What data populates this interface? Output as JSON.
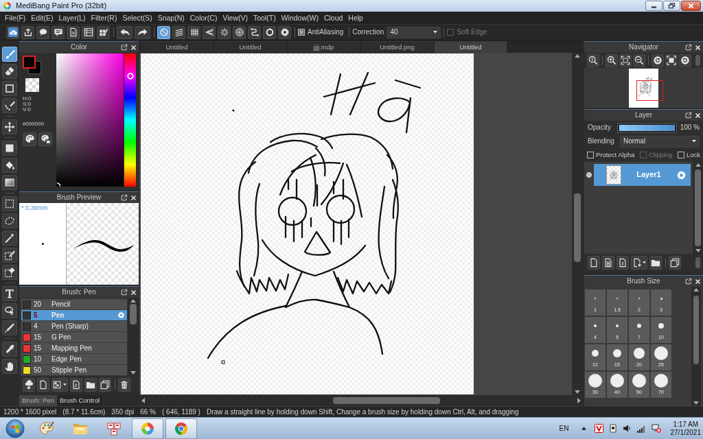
{
  "window": {
    "title": "MediBang Paint Pro (32bit)"
  },
  "menu": [
    "File(F)",
    "Edit(E)",
    "Layer(L)",
    "Filter(R)",
    "Select(S)",
    "Snap(N)",
    "Color(C)",
    "View(V)",
    "Tool(T)",
    "Window(W)",
    "Cloud",
    "Help"
  ],
  "toolbar": {
    "snap_modes": [
      {
        "selected": true
      },
      {
        "selected": false
      },
      {
        "selected": false
      },
      {
        "selected": false
      },
      {
        "selected": false
      },
      {
        "selected": false
      },
      {
        "selected": false
      },
      {
        "selected": false
      }
    ],
    "antialiasing": {
      "label": "AntiAliasing",
      "checked": true
    },
    "correction": {
      "label": "Correction",
      "value": "40"
    },
    "soft_edge": {
      "label": "Soft Edge",
      "checked": false,
      "disabled": true
    }
  },
  "tool_groups": [
    [
      {
        "selected": true
      },
      {
        "selected": false
      },
      {
        "selected": false
      },
      {
        "selected": false
      }
    ],
    [
      {
        "selected": false
      }
    ],
    [
      {
        "selected": false
      },
      {
        "selected": false
      },
      {
        "selected": false
      }
    ],
    [
      {
        "selected": false
      },
      {
        "selected": false
      },
      {
        "selected": false
      },
      {
        "selected": false
      },
      {
        "selected": false
      }
    ],
    [
      {
        "selected": false
      },
      {
        "selected": false
      },
      {
        "selected": false
      }
    ],
    [
      {
        "selected": false
      },
      {
        "selected": false
      }
    ]
  ],
  "color_panel": {
    "title": "Color",
    "hsv": [
      "H:0",
      "S:0",
      "V:0"
    ],
    "hex": "#000000",
    "hue_slider": {
      "level": 0.85
    }
  },
  "brush_preview": {
    "title": "Brush Preview",
    "size": "* 0.36mm"
  },
  "brush_panel": {
    "title": "Brush: Pen",
    "brushes": [
      {
        "size": "20",
        "name": "Pencil",
        "color": "#333333",
        "selected": false
      },
      {
        "size": "5",
        "name": "Pen",
        "color": "#333333",
        "selected": true
      },
      {
        "size": "4",
        "name": "Pen (Sharp)",
        "color": "#333333",
        "selected": false
      },
      {
        "size": "15",
        "name": "G Pen",
        "color": "#ee3333",
        "selected": false
      },
      {
        "size": "15",
        "name": "Mapping Pen",
        "color": "#ee3333",
        "selected": false
      },
      {
        "size": "10",
        "name": "Edge Pen",
        "color": "#22aa22",
        "selected": false
      },
      {
        "size": "50",
        "name": "Stipple Pen",
        "color": "#eedd22",
        "selected": false
      }
    ]
  },
  "left_tabs": [
    {
      "label": "Brush: Pen",
      "selected": true
    },
    {
      "label": "Brush Control",
      "selected": false
    }
  ],
  "canvas": {
    "tabs": [
      {
        "label": "Untitled",
        "selected": false
      },
      {
        "label": "Untitled",
        "selected": false
      },
      {
        "label": "jjjj.mdp",
        "selected": false
      },
      {
        "label": "Untitled.png",
        "selected": false
      },
      {
        "label": "Untitled",
        "selected": true
      }
    ]
  },
  "navigator": {
    "title": "Navigator"
  },
  "layer_panel": {
    "title": "Layer",
    "opacity": {
      "label": "Opacity",
      "level": 1,
      "reading": "100 %"
    },
    "blending": {
      "label": "Blending",
      "value": "Normal"
    },
    "options": [
      {
        "label": "Protect Alpha",
        "checked": false,
        "disabled": false
      },
      {
        "label": "Clipping",
        "checked": false,
        "disabled": true
      },
      {
        "label": "Lock",
        "checked": false,
        "disabled": false
      }
    ],
    "layers": [
      {
        "name": "Layer1",
        "selected": true,
        "visible": true
      }
    ]
  },
  "brush_size_panel": {
    "title": "Brush Size",
    "sizes": [
      "1",
      "1.5",
      "2",
      "3",
      "4",
      "5",
      "7",
      "10",
      "12",
      "15",
      "20",
      "25",
      "30",
      "40",
      "50",
      "70"
    ]
  },
  "status_bar": {
    "items": [
      "1200 * 1600 pixel",
      "(8.7 * 11.6cm)",
      "350 dpi",
      "66 %",
      "( 646, 1189 )"
    ],
    "hint": "Draw a straight line by holding down Shift, Change a brush size by holding down Ctrl, Alt, and dragging"
  },
  "taskbar": {
    "apps": [
      {
        "active": false
      },
      {
        "active": false
      },
      {
        "active": false
      },
      {
        "active": true
      },
      {
        "active": true
      }
    ],
    "language": "EN",
    "time": "1:17 AM",
    "date": "27/1/2021"
  }
}
